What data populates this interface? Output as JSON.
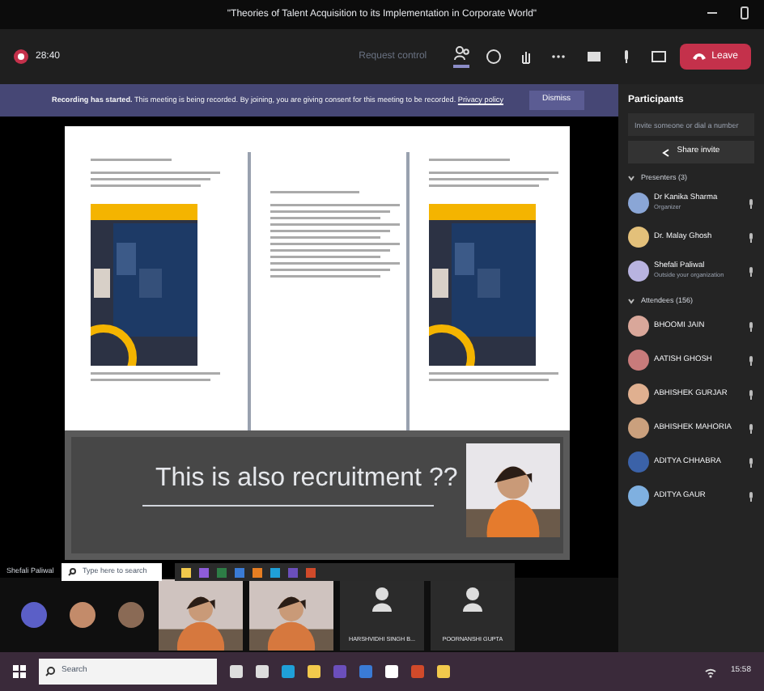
{
  "window": {
    "title": "\"Theories of Talent Acquisition to its Implementation in Corporate World\""
  },
  "toolbar": {
    "timer": "28:40",
    "request_control": "Request control",
    "leave": "Leave"
  },
  "banner": {
    "message": "**Recording has started.** This meeting is being recorded. By joining, you are giving consent for this meeting to be recorded.",
    "link": "Privacy policy",
    "dismiss": "Dismiss"
  },
  "stage": {
    "slide_title": "This is also recruitment ??",
    "presenter_label": "Shefali Paliwal",
    "shared_search": "Type here to search"
  },
  "video_strip": {
    "tiles": [
      {
        "kind": "avatar"
      },
      {
        "kind": "avatar"
      },
      {
        "kind": "avatar"
      },
      {
        "kind": "video"
      },
      {
        "kind": "video"
      },
      {
        "kind": "named",
        "name": "HARSHVIDHI SINGH B..."
      },
      {
        "kind": "named",
        "name": "POORNANSHI GUPTA"
      }
    ]
  },
  "participants": {
    "title": "Participants",
    "invite_placeholder": "Invite someone or dial a number",
    "share": "Share invite",
    "sections": [
      {
        "label": "Presenters (3)",
        "people": [
          {
            "name": "Dr Kanika Sharma",
            "subtitle": "Organizer"
          },
          {
            "name": "Dr. Malay Ghosh"
          },
          {
            "name": "Shefali Paliwal",
            "subtitle": "Outside your organization"
          }
        ]
      },
      {
        "label": "Attendees (156)",
        "people": [
          {
            "name": "BHOOMI JAIN"
          },
          {
            "name": "AATISH GHOSH"
          },
          {
            "name": "ABHISHEK GURJAR"
          },
          {
            "name": "ABHISHEK MAHORIA"
          },
          {
            "name": "ADITYA CHHABRA"
          },
          {
            "name": "ADITYA GAUR"
          }
        ]
      }
    ]
  },
  "taskbar": {
    "search": "Search",
    "time": "15:58"
  }
}
